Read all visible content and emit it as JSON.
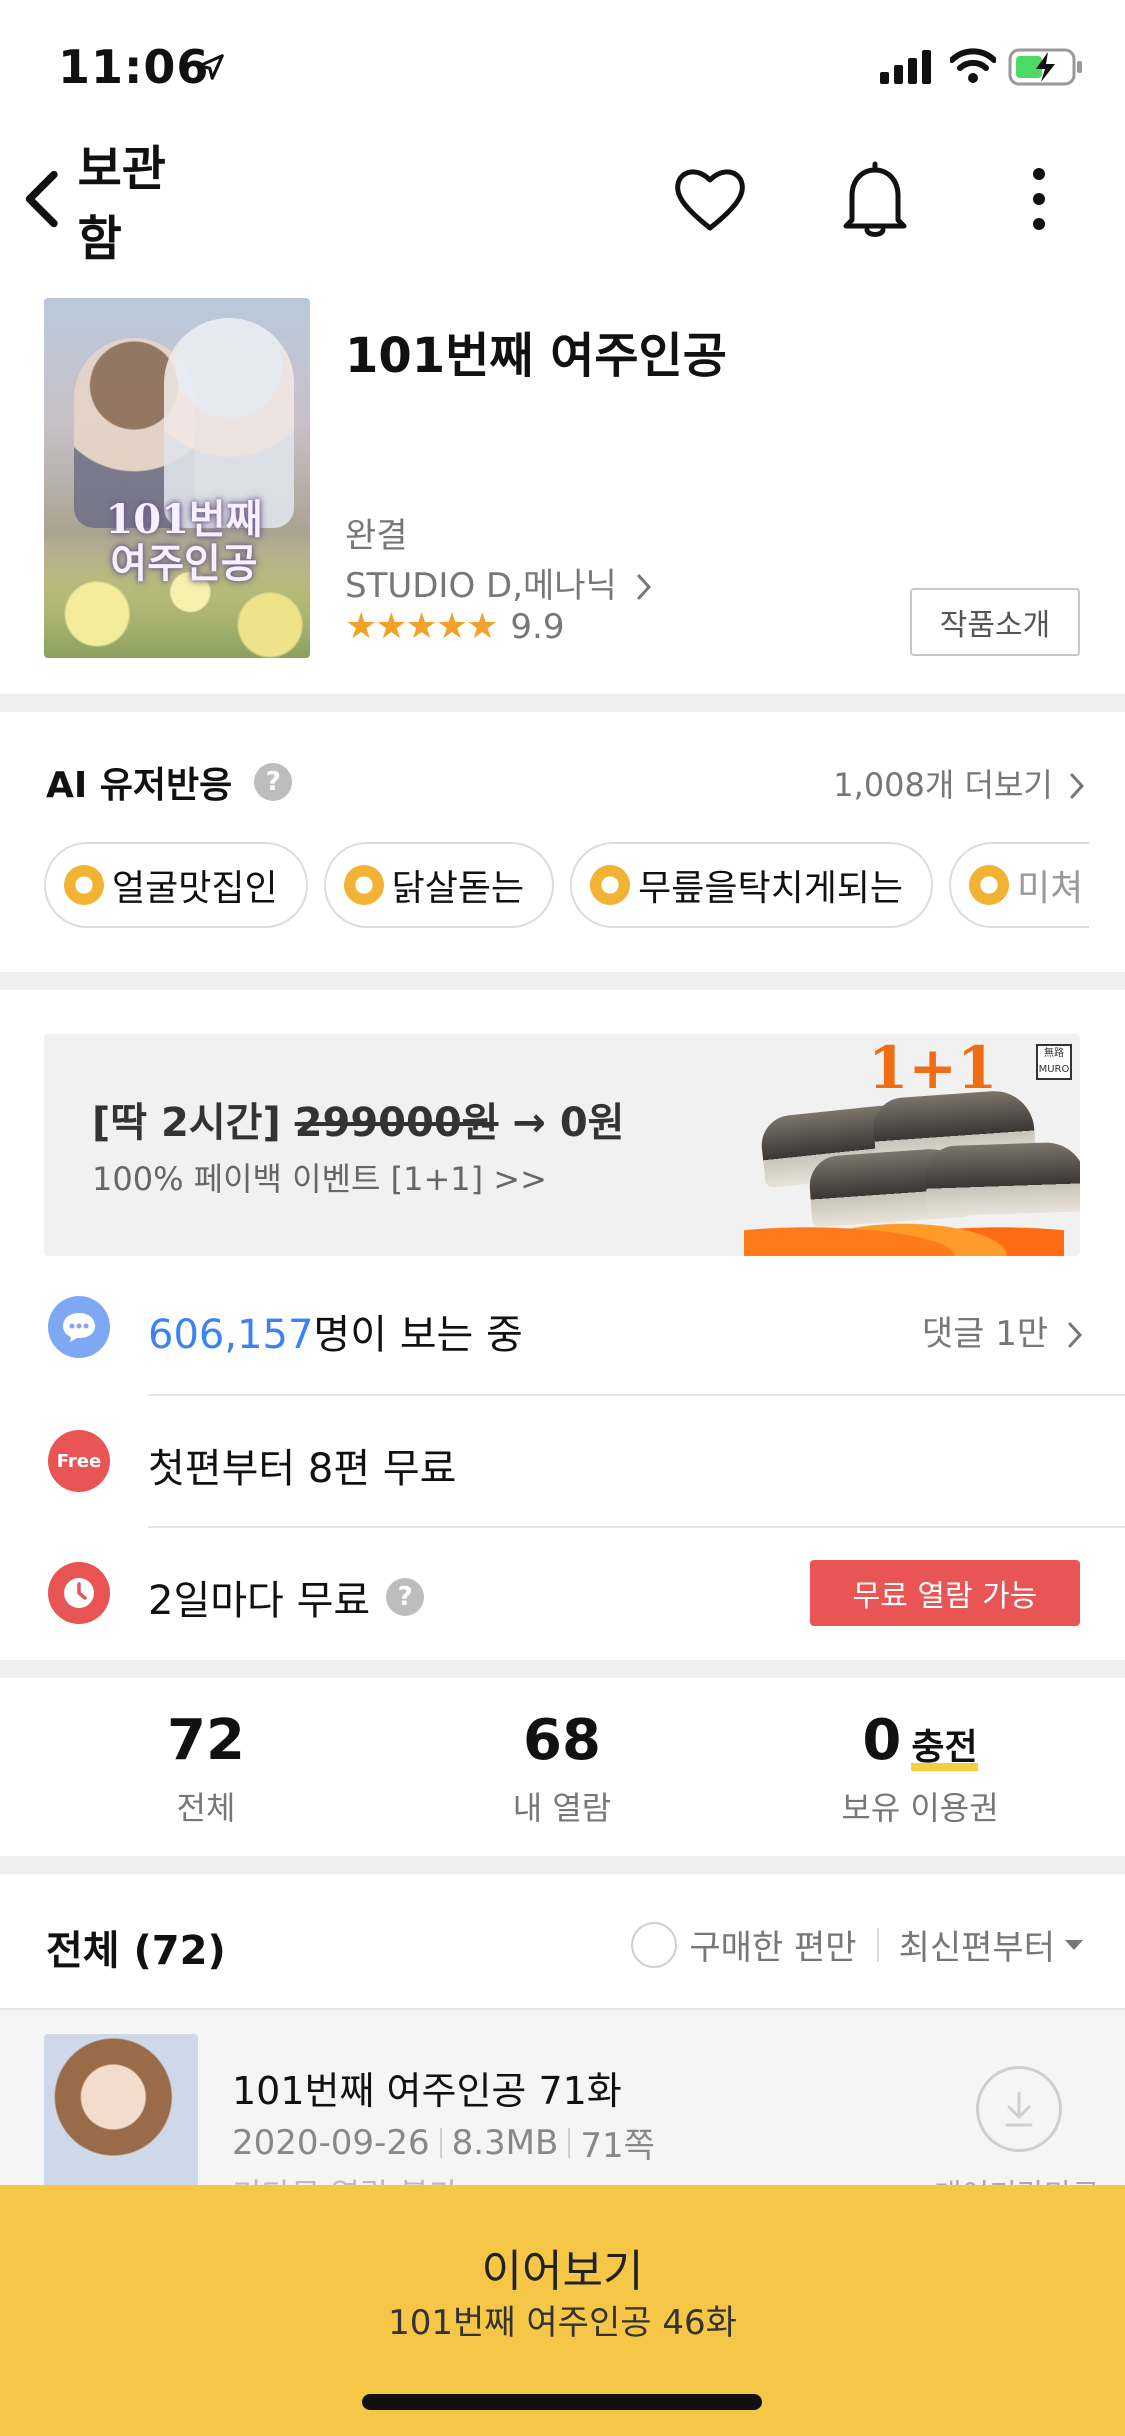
{
  "status_bar": {
    "time": "11:06"
  },
  "nav": {
    "back_label": "보관함"
  },
  "work": {
    "cover_title": "101번째 여주인공",
    "title": "101번째 여주인공",
    "status": "완결",
    "author": "STUDIO D,메나닉",
    "stars": "★★★★★",
    "rating": "9.9",
    "intro_button": "작품소개"
  },
  "ai_reactions": {
    "title": "AI 유저반응",
    "help": "?",
    "more": "1,008개 더보기",
    "chips": [
      "얼굴맛집인",
      "닭살돋는",
      "무릎을탁치게되는",
      "미쳐"
    ]
  },
  "banner": {
    "headline_prefix": "[딱 2시간] ",
    "headline_strike": "299000원",
    "headline_suffix": " → 0원",
    "sub": "100% 페이백 이벤트 [1+1] >>",
    "badge": "1+1",
    "brand": "無路 MURO"
  },
  "viewers": {
    "count": "606,157",
    "suffix": "명이 보는 중",
    "comments": "댓글 1만"
  },
  "free_first": {
    "badge": "Free",
    "text": "첫편부터 8편 무료"
  },
  "wait_free": {
    "text": "2일마다 무료",
    "help": "?",
    "button": "무료 열람 가능"
  },
  "stats": {
    "total_num": "72",
    "total_label": "전체",
    "read_num": "68",
    "read_label": "내 열람",
    "owned_num": "0",
    "charge_label": "충전",
    "owned_label": "보유 이용권"
  },
  "list": {
    "title": "전체 (72)",
    "purchased_only": "구매한 편만",
    "sort": "최신편부터"
  },
  "episode": {
    "title": "101번째 여주인공 71화",
    "date": "2020-09-26",
    "size": "8.3MB",
    "pages": "71쪽",
    "wait_text": "기다무 열람 불가",
    "download_label": "대여기간만료"
  },
  "continue_bar": {
    "label": "이어보기",
    "episode": "101번째 여주인공 46화"
  },
  "colors": {
    "accent_yellow": "#f6c747",
    "link_blue": "#3b82f6",
    "red": "#e95555",
    "star": "#f0a22a"
  }
}
